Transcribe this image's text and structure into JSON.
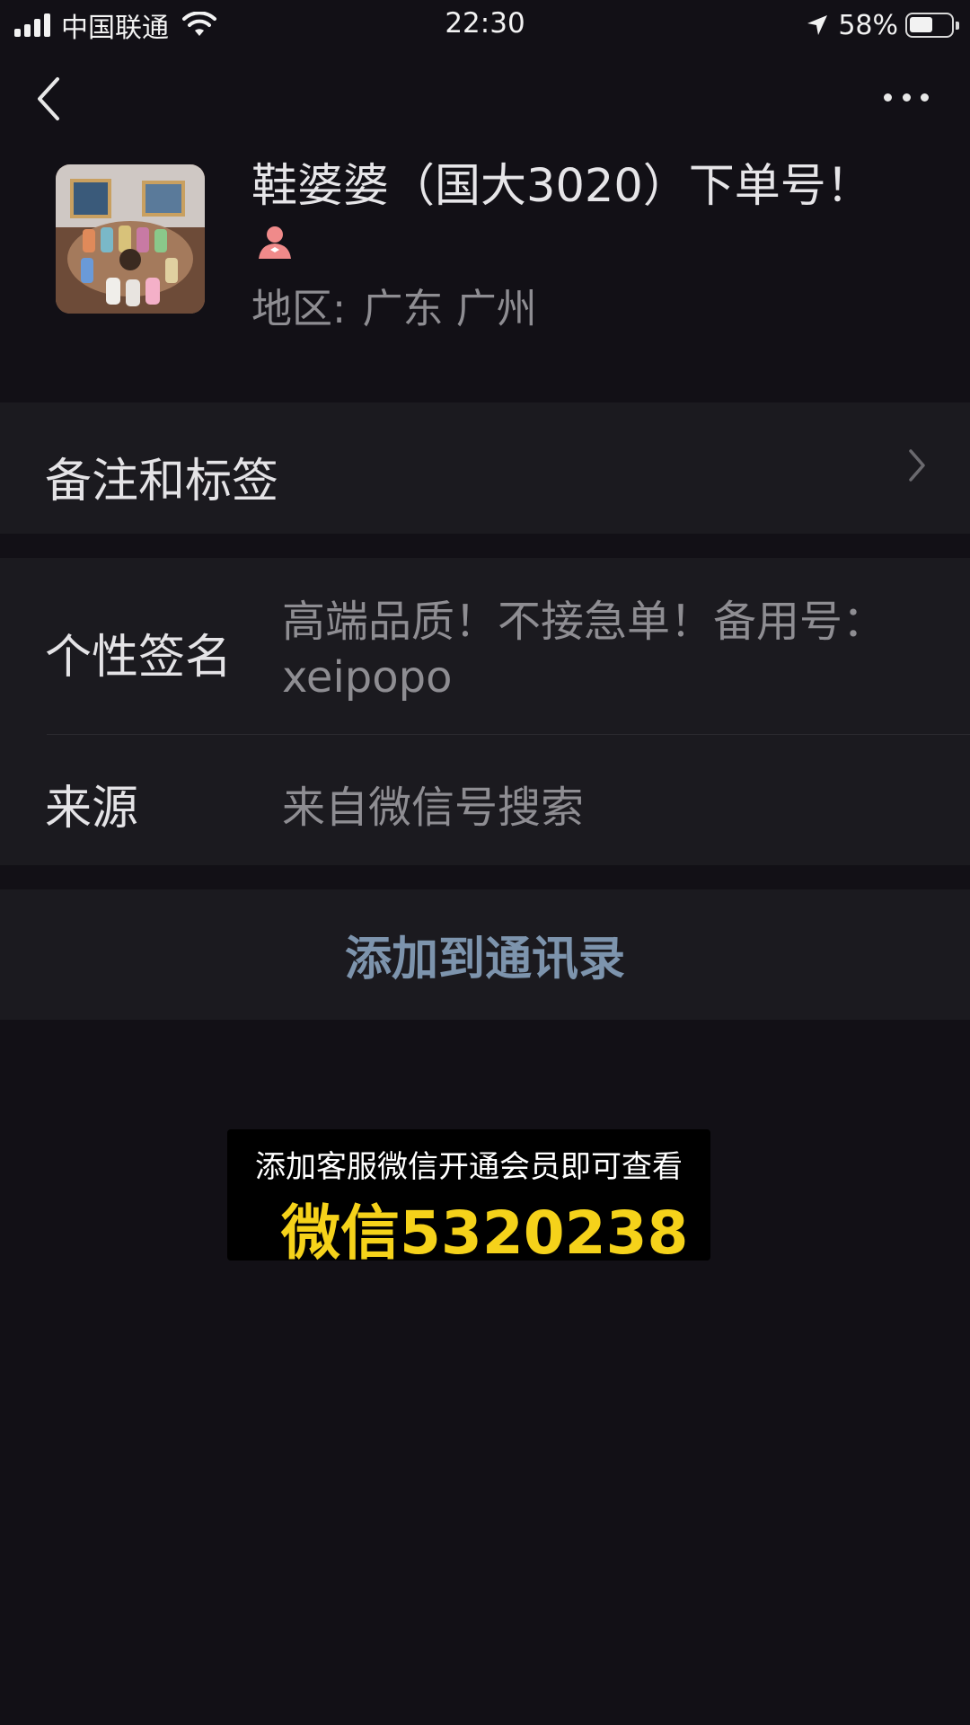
{
  "status_bar": {
    "carrier": "中国联通",
    "time": "22:30",
    "battery_percent": "58%",
    "battery_level": 0.58,
    "icons": [
      "signal-icon",
      "wifi-icon",
      "location-arrow-icon",
      "battery-icon"
    ]
  },
  "nav": {
    "back_icon": "chevron-left-icon",
    "more_icon": "more-dots-icon"
  },
  "profile": {
    "name": "鞋婆婆（国大3020）下单号！",
    "gender_icon": "female-icon",
    "gender_color": "#f08a8a",
    "region_label": "地区:",
    "region_value": "广东 广州"
  },
  "remark": {
    "label": "备注和标签",
    "icon": "chevron-right-icon"
  },
  "signature": {
    "label": "个性签名",
    "value": "高端品质！不接急单！备用号：xeipopo"
  },
  "source": {
    "label": "来源",
    "value": "来自微信号搜索"
  },
  "actions": {
    "add_contact": "添加到通讯录"
  },
  "promo": {
    "line1": "添加客服微信开通会员即可查看",
    "line2": "微信5320238",
    "highlight_color": "#f5d21a"
  },
  "colors": {
    "background": "#121016",
    "cell_background": "#1b1a1f",
    "link_blue": "#7d94ad",
    "secondary_text": "#8e8d92"
  }
}
